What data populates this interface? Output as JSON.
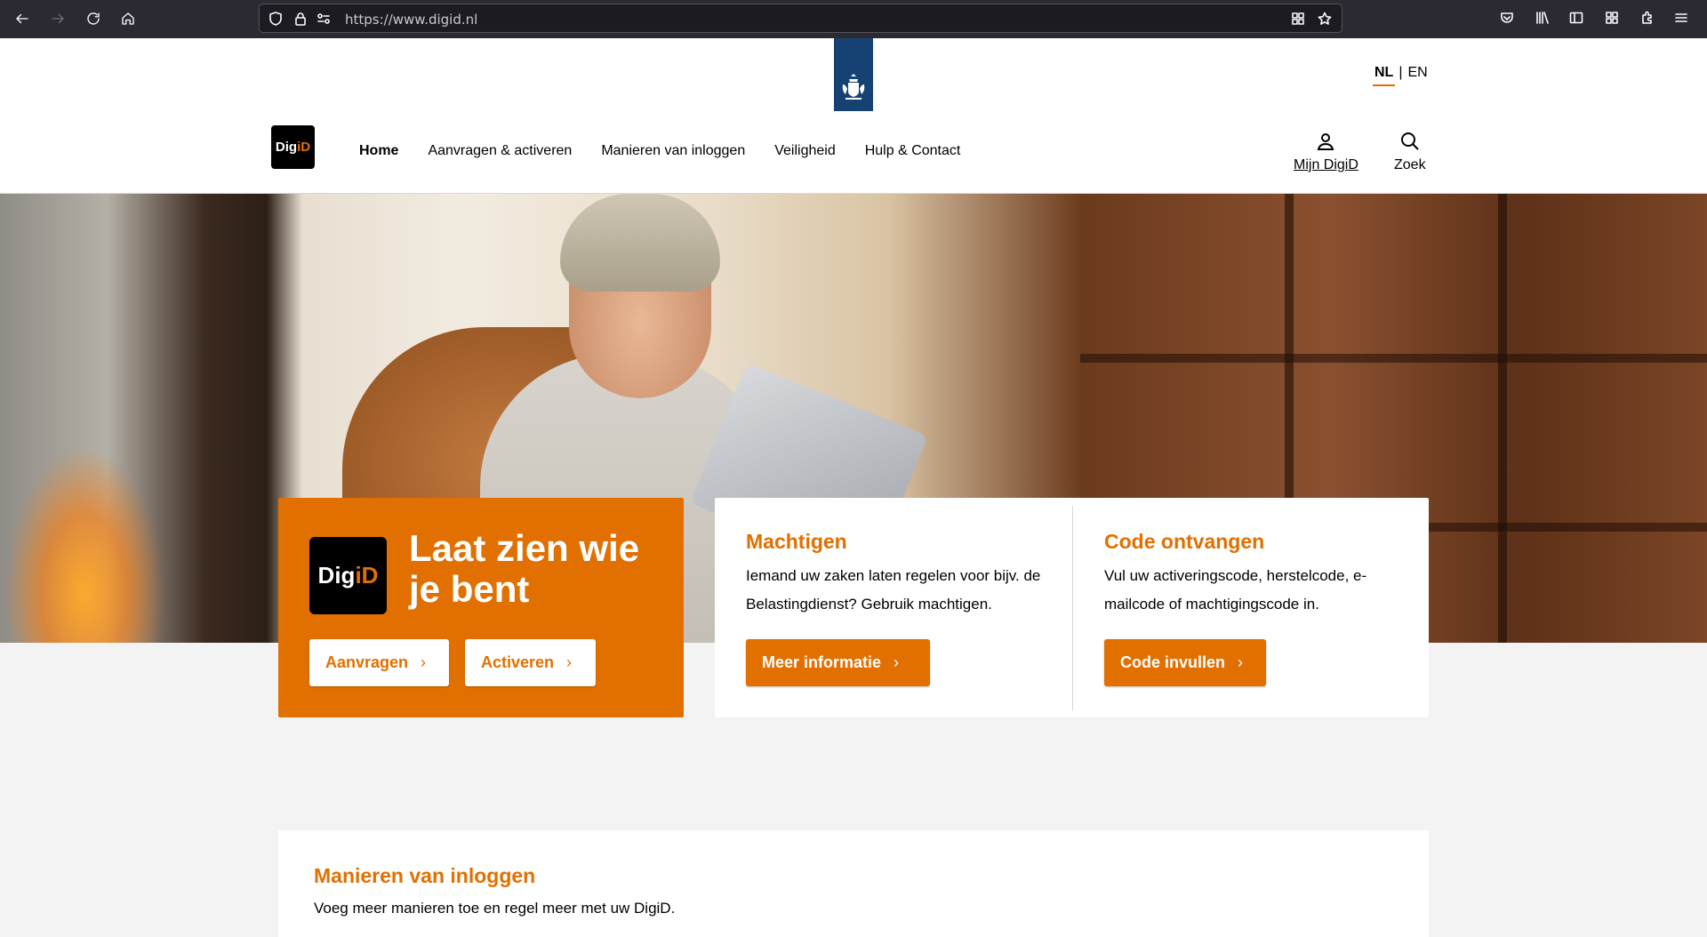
{
  "browser": {
    "url": "https://www.digid.nl"
  },
  "header": {
    "lang_nl": "NL",
    "lang_sep": "|",
    "lang_en": "EN",
    "logo_small_a": "Dig",
    "logo_small_b": "iD",
    "nav": [
      {
        "label": "Home"
      },
      {
        "label": "Aanvragen & activeren"
      },
      {
        "label": "Manieren van inloggen"
      },
      {
        "label": "Veiligheid"
      },
      {
        "label": "Hulp & Contact"
      }
    ],
    "mijn_digid": "Mijn DigiD",
    "zoek": "Zoek"
  },
  "hero": {
    "logo_a": "Dig",
    "logo_b": "iD",
    "slogan": "Laat zien wie je bent",
    "btn_aanvragen": "Aanvragen",
    "btn_activeren": "Activeren"
  },
  "cards": {
    "machtigen": {
      "title": "Machtigen",
      "text": "Iemand uw zaken laten regelen voor bijv. de Belastingdienst? Gebruik machtigen.",
      "button": "Meer informatie"
    },
    "code": {
      "title": "Code ontvangen",
      "text": "Vul uw activeringscode, herstelcode, e-mailcode of machtigingscode in.",
      "button": "Code invullen"
    }
  },
  "login_section": {
    "title": "Manieren van inloggen",
    "text": "Voeg meer manieren toe en regel meer met uw DigiD."
  },
  "colors": {
    "accent": "#e17000",
    "rijks_blue": "#154273",
    "browser_chrome": "#2b2a33"
  }
}
